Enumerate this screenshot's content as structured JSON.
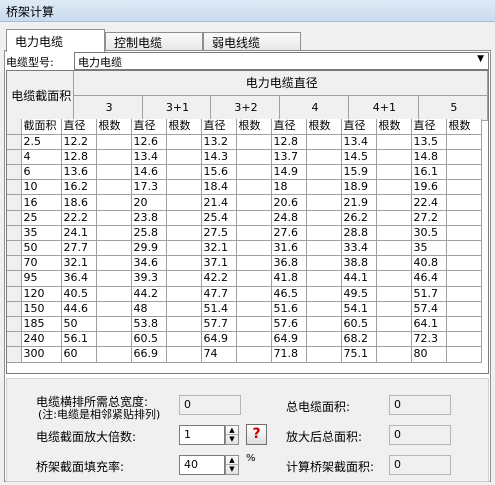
{
  "window": {
    "title": "桥架计算"
  },
  "tabs": [
    "电力电缆",
    "控制电缆",
    "弱电线缆"
  ],
  "cable_type": {
    "label": "电缆型号:",
    "value": "电力电缆"
  },
  "grid": {
    "section_header": "电缆截面积",
    "diameter_header": "电力电缆直径",
    "groups": [
      "3",
      "3+1",
      "3+2",
      "4",
      "4+1",
      "5"
    ],
    "col_section": "截面积",
    "col_diameter": "直径",
    "col_count": "根数",
    "rows": [
      [
        "2.5",
        "12.2",
        "12.6",
        "13.2",
        "12.8",
        "13.4",
        "13.5"
      ],
      [
        "4",
        "12.8",
        "13.4",
        "14.3",
        "13.7",
        "14.5",
        "14.8"
      ],
      [
        "6",
        "13.6",
        "14.6",
        "15.6",
        "14.9",
        "15.9",
        "16.1"
      ],
      [
        "10",
        "16.2",
        "17.3",
        "18.4",
        "18",
        "18.9",
        "19.6"
      ],
      [
        "16",
        "18.6",
        "20",
        "21.4",
        "20.6",
        "21.9",
        "22.4"
      ],
      [
        "25",
        "22.2",
        "23.8",
        "25.4",
        "24.8",
        "26.2",
        "27.2"
      ],
      [
        "35",
        "24.1",
        "25.8",
        "27.5",
        "27.6",
        "28.8",
        "30.5"
      ],
      [
        "50",
        "27.7",
        "29.9",
        "32.1",
        "31.6",
        "33.4",
        "35"
      ],
      [
        "70",
        "32.1",
        "34.6",
        "37.1",
        "36.8",
        "38.8",
        "40.8"
      ],
      [
        "95",
        "36.4",
        "39.3",
        "42.2",
        "41.8",
        "44.1",
        "46.4"
      ],
      [
        "120",
        "40.5",
        "44.2",
        "47.7",
        "46.5",
        "49.5",
        "51.7"
      ],
      [
        "150",
        "44.6",
        "48",
        "51.4",
        "51.6",
        "54.1",
        "57.4"
      ],
      [
        "185",
        "50",
        "53.8",
        "57.7",
        "57.6",
        "60.5",
        "64.1"
      ],
      [
        "240",
        "56.1",
        "60.5",
        "64.9",
        "64.9",
        "68.2",
        "72.3"
      ],
      [
        "300",
        "60",
        "66.9",
        "74",
        "71.8",
        "75.1",
        "80"
      ]
    ]
  },
  "bottom": {
    "total_width_label": "电缆横排所需总宽度:",
    "total_width_note": "(注:电缆是相邻紧贴排列)",
    "total_width_value": "0",
    "total_area_label": "总电缆面积:",
    "total_area_value": "0",
    "magnify_label": "电缆截面放大倍数:",
    "magnify_value": "1",
    "help_label": "?",
    "magnified_area_label": "放大后总面积:",
    "magnified_area_value": "0",
    "fill_rate_label": "桥架截面填充率:",
    "fill_rate_value": "40",
    "fill_rate_unit": "%",
    "tray_area_label": "计算桥架截面积:",
    "tray_area_value": "0"
  }
}
